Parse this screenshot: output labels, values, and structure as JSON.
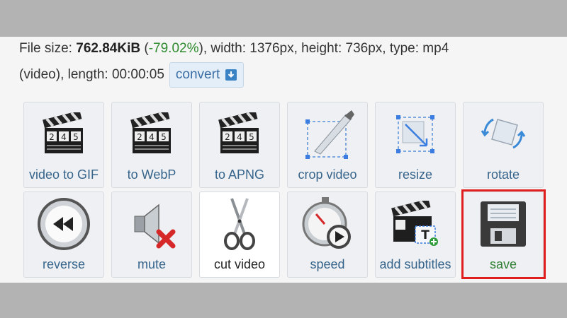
{
  "file_info": {
    "size_label": "File size: ",
    "size_value": "762.84KiB",
    "size_change_open": " (",
    "size_change": "-79.02%",
    "size_change_close": ")",
    "dims": ", width: 1376px, height: 736px, type: mp4",
    "line2": "(video), length: 00:00:05",
    "convert_label": "convert"
  },
  "tools": [
    {
      "label": "video to GIF",
      "icon": "clapperboard-icon"
    },
    {
      "label": "to WebP",
      "icon": "clapperboard-icon"
    },
    {
      "label": "to APNG",
      "icon": "clapperboard-icon"
    },
    {
      "label": "crop video",
      "icon": "crop-knife-icon"
    },
    {
      "label": "resize",
      "icon": "resize-icon"
    },
    {
      "label": "rotate",
      "icon": "rotate-icon"
    },
    {
      "label": "reverse",
      "icon": "rewind-icon"
    },
    {
      "label": "mute",
      "icon": "speaker-mute-icon"
    },
    {
      "label": "cut video",
      "icon": "scissors-icon"
    },
    {
      "label": "speed",
      "icon": "stopwatch-icon"
    },
    {
      "label": "add subtitles",
      "icon": "clapperboard-subtitle-icon"
    },
    {
      "label": "save",
      "icon": "floppy-disk-icon"
    }
  ],
  "clapper_digits": [
    "2",
    "4",
    "5"
  ],
  "subtitle_glyph": "T",
  "colors": {
    "highlight": "#e01e1e",
    "link": "#36648b",
    "percent": "#2e8b2e"
  }
}
